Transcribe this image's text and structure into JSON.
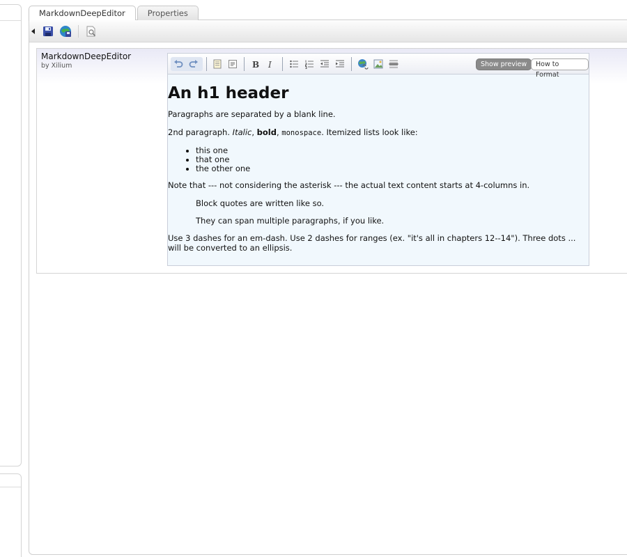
{
  "tabs": [
    {
      "label": "MarkdownDeepEditor",
      "active": true
    },
    {
      "label": "Properties",
      "active": false
    }
  ],
  "toolbar": {
    "buttons": [
      "collapse-arrow-icon",
      "save-icon",
      "save-publish-icon",
      "preview-icon"
    ]
  },
  "widget": {
    "title": "MarkdownDeepEditor",
    "author": "by Xilium"
  },
  "editor": {
    "toolbar_icons": [
      "undo-icon",
      "redo-icon",
      "heading-icon",
      "code-icon",
      "bold-icon",
      "italic-icon",
      "bullet-list-icon",
      "numbered-list-icon",
      "outdent-icon",
      "indent-icon",
      "link-icon",
      "image-icon",
      "horizontal-rule-icon"
    ],
    "show_preview_label": "Show preview",
    "how_to_format_label": "How to Format"
  },
  "preview": {
    "h1": "An h1 header",
    "p1": "Paragraphs are separated by a blank line.",
    "p2": {
      "a": "2nd paragraph. ",
      "italic": "Italic",
      "b": ", ",
      "bold": "bold",
      "c": ", ",
      "mono": "monospace",
      "d": ". Itemized lists look like:"
    },
    "list": [
      "this one",
      "that one",
      "the other one"
    ],
    "p3": "Note that --- not considering the asterisk --- the actual text content starts at 4-columns in.",
    "quotes": [
      "Block quotes are written like so.",
      "They can span multiple paragraphs, if you like."
    ],
    "p4": "Use 3 dashes for an em-dash. Use 2 dashes for ranges (ex. \"it's all in chapters 12--14\"). Three dots ... will be converted to an ellipsis."
  },
  "colors": {
    "preview_bg": "#f1f8fd",
    "active_pill": "#8a8a8a",
    "icon_blue": "#2b5fb4"
  }
}
